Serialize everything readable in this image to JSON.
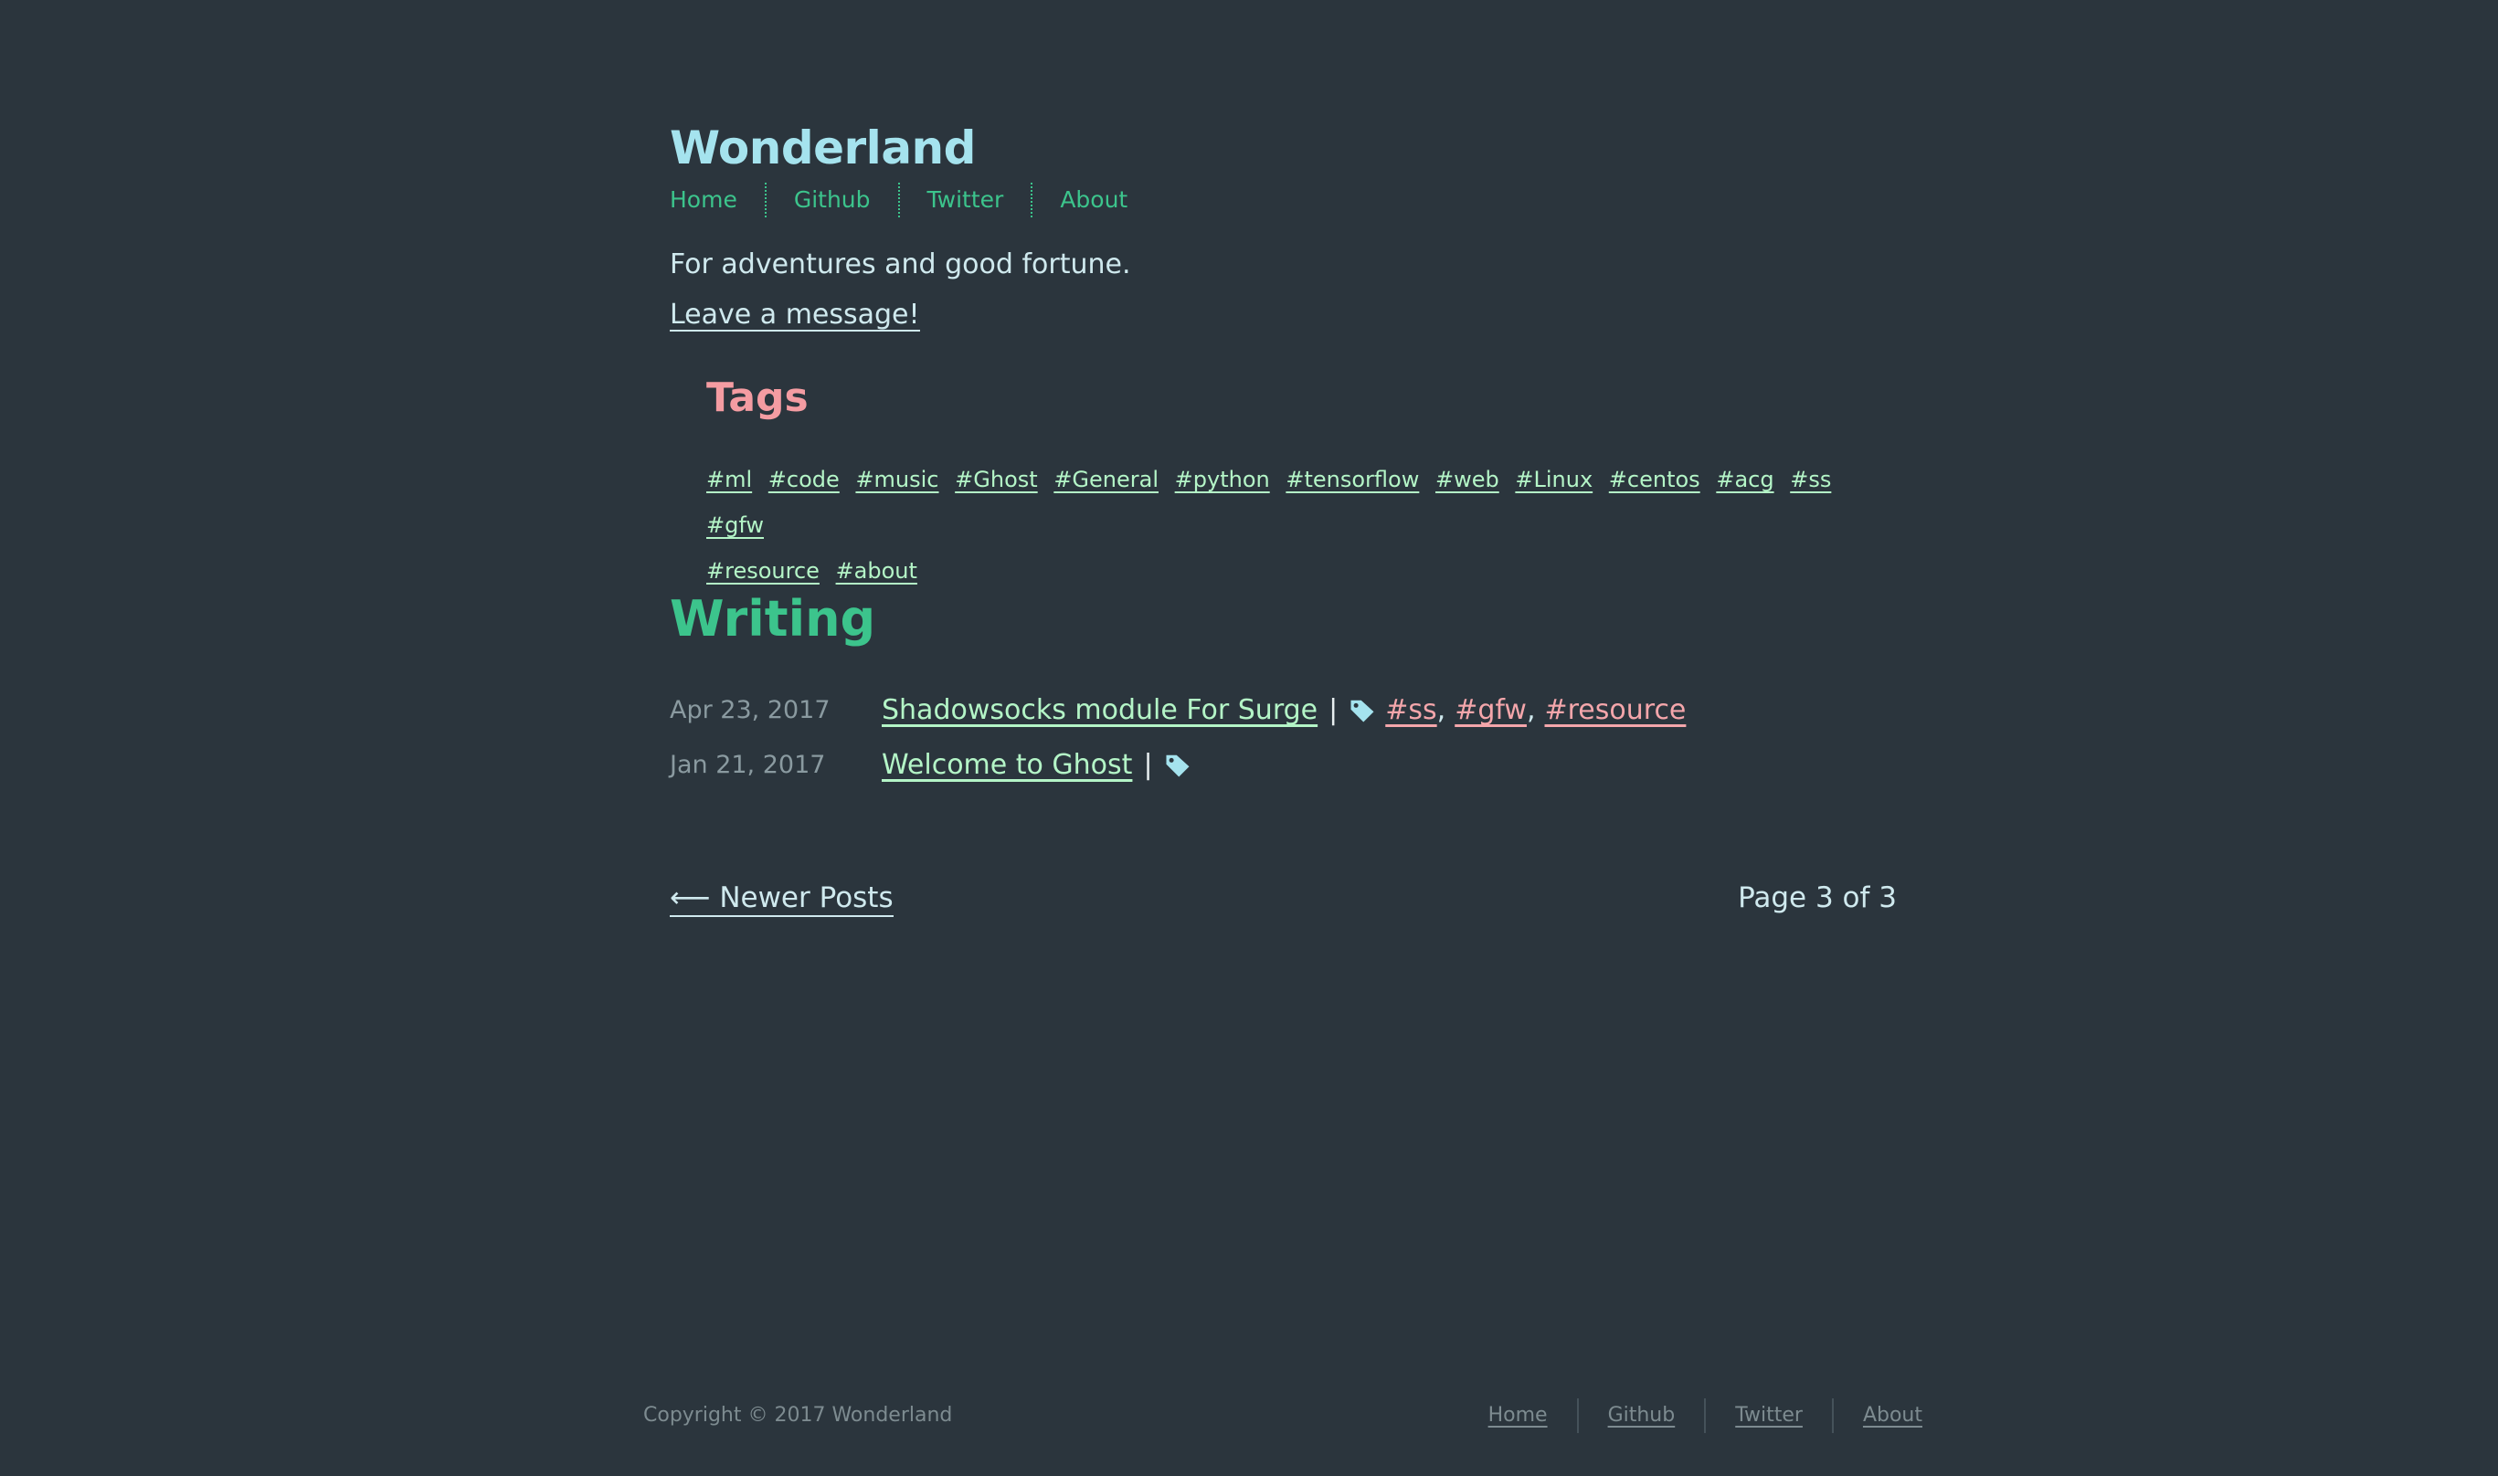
{
  "site": {
    "title": "Wonderland",
    "tagline": "For adventures and good fortune.",
    "message_link": "Leave a message!"
  },
  "nav": {
    "items": [
      {
        "label": "Home"
      },
      {
        "label": "Github"
      },
      {
        "label": "Twitter"
      },
      {
        "label": "About"
      }
    ]
  },
  "tags": {
    "title": "Tags",
    "items": [
      "#ml",
      "#code",
      "#music",
      "#Ghost",
      "#General",
      "#python",
      "#tensorflow",
      "#web",
      "#Linux",
      "#centos",
      "#acg",
      "#ss",
      "#gfw",
      "#resource",
      "#about"
    ]
  },
  "writing": {
    "title": "Writing",
    "posts": [
      {
        "date": "Apr 23, 2017",
        "title": "Shadowsocks module For Surge",
        "separator": "|",
        "tags": [
          "#ss",
          "#gfw",
          "#resource"
        ]
      },
      {
        "date": "Jan 21, 2017",
        "title": "Welcome to Ghost",
        "separator": "|",
        "tags": []
      }
    ]
  },
  "pagination": {
    "newer_arrow": "⟵",
    "newer_label": "Newer Posts",
    "page_status": "Page 3 of 3"
  },
  "footer": {
    "copyright": "Copyright © 2017 Wonderland",
    "nav": [
      {
        "label": "Home"
      },
      {
        "label": "Github"
      },
      {
        "label": "Twitter"
      },
      {
        "label": "About"
      }
    ]
  },
  "colors": {
    "background": "#2b353d",
    "title": "#a5e3ee",
    "accent_green": "#3cc48c",
    "tags_heading": "#f49ca2",
    "link_green": "#b4f5c7",
    "post_tag_pink": "#f4a6ab"
  },
  "icons": {
    "tag": "tag-icon"
  }
}
